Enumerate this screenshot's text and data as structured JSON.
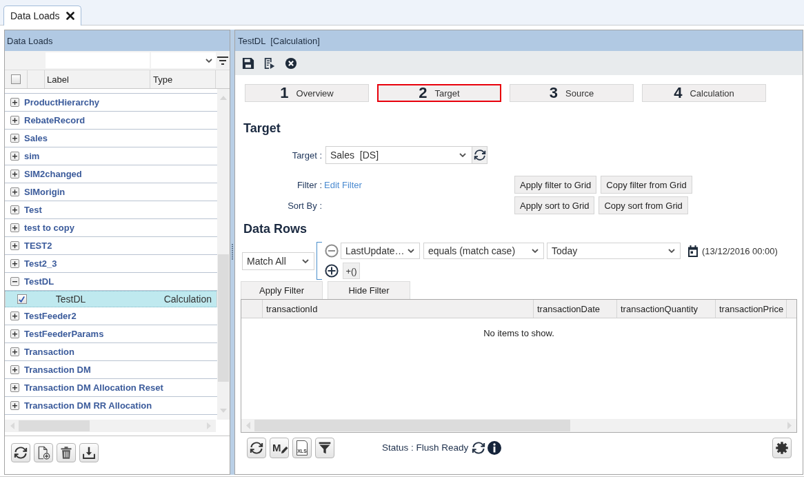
{
  "tabs": [
    {
      "label": "Data Loads",
      "selected": true
    }
  ],
  "left_panel": {
    "title": "Data Loads",
    "select_all": {
      "checked": false
    },
    "columns": [
      "Label",
      "Type"
    ],
    "items": [
      {
        "label": "ProductHierarchy",
        "expanded": false,
        "selected": false
      },
      {
        "label": "RebateRecord",
        "expanded": false,
        "selected": false
      },
      {
        "label": "Sales",
        "expanded": false,
        "selected": false
      },
      {
        "label": "sim",
        "expanded": false,
        "selected": false
      },
      {
        "label": "SIM2changed",
        "expanded": false,
        "selected": false
      },
      {
        "label": "SIMorigin",
        "expanded": false,
        "selected": false
      },
      {
        "label": "Test",
        "expanded": false,
        "selected": false
      },
      {
        "label": "test to copy",
        "expanded": false,
        "selected": false
      },
      {
        "label": "TEST2",
        "expanded": false,
        "selected": false
      },
      {
        "label": "Test2_3",
        "expanded": false,
        "selected": false
      },
      {
        "label": "TestDL",
        "expanded": true,
        "selected": false,
        "children": [
          {
            "label": "TestDL",
            "type": "Calculation",
            "checked": true,
            "selected": true
          }
        ]
      },
      {
        "label": "TestFeeder2",
        "expanded": false,
        "selected": false
      },
      {
        "label": "TestFeederParams",
        "expanded": false,
        "selected": false
      },
      {
        "label": "Transaction",
        "expanded": false,
        "selected": false
      },
      {
        "label": "Transaction DM",
        "expanded": false,
        "selected": false
      },
      {
        "label": "Transaction DM Allocation Reset",
        "expanded": false,
        "selected": false
      },
      {
        "label": "Transaction DM RR Allocation",
        "expanded": false,
        "selected": false
      }
    ]
  },
  "detail_panel": {
    "title": "TestDL  [Calculation]",
    "steps": [
      {
        "number": "1",
        "label": "Overview",
        "selected": false
      },
      {
        "number": "2",
        "label": "Target",
        "selected": true
      },
      {
        "number": "3",
        "label": "Source",
        "selected": false
      },
      {
        "number": "4",
        "label": "Calculation",
        "selected": false
      }
    ],
    "target_section": {
      "heading": "Target",
      "target_label": "Target :",
      "target_value": "Sales  [DS]",
      "filter_label": "Filter :",
      "filter_link": "Edit Filter",
      "sort_label": "Sort By :",
      "filter_buttons": [
        "Apply filter to Grid",
        "Copy filter from Grid"
      ],
      "sort_buttons": [
        "Apply sort to Grid",
        "Copy sort from Grid"
      ]
    },
    "data_rows": {
      "heading": "Data Rows",
      "match": "Match All",
      "conditions": [
        {
          "field": "LastUpdate…",
          "operator": "equals (match case)",
          "value": "Today",
          "date": "(13/12/2016 00:00)"
        }
      ],
      "group_button": "+()",
      "apply_button": "Apply Filter",
      "hide_button": "Hide Filter"
    },
    "table": {
      "columns": [
        "transactionId",
        "transactionDate",
        "transactionQuantity",
        "transactionPrice"
      ],
      "empty_message": "No items to show."
    },
    "grid_toolbar": {
      "edit_letter": "M",
      "export_label": "XLS"
    },
    "status": "Status : Flush Ready"
  }
}
